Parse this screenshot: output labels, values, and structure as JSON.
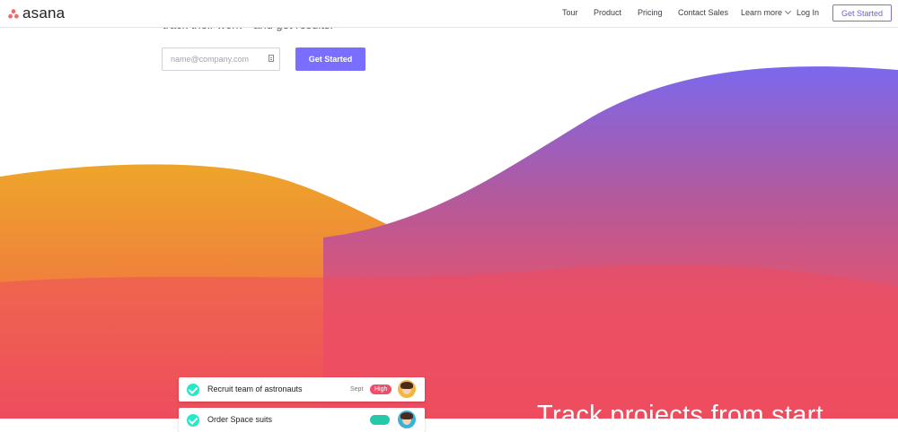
{
  "nav": {
    "brand": "asana",
    "links": [
      "Tour",
      "Product",
      "Pricing",
      "Contact Sales",
      "Learn more",
      "Log In"
    ],
    "cta": "Get Started"
  },
  "hero": {
    "tagline": "track their work—and get results.",
    "email_placeholder": "name@company.com",
    "email_value": "",
    "cta": "Get Started"
  },
  "tasks": [
    {
      "title": "Recruit team of astronauts",
      "date": "Sept",
      "tag": "High"
    },
    {
      "title": "Order Space suits",
      "date": "",
      "tag": ""
    }
  ],
  "section": {
    "title": "Track projects from start"
  },
  "colors": {
    "accent": "#796eff",
    "wave_orange": "#f0a52a",
    "wave_pink": "#ee4d5e",
    "wave_purple": "#7b68ee",
    "check": "#25e8c8",
    "tag_high": "#ef4e6b"
  },
  "icons": [
    "asana-logo-icon",
    "chevron-down-icon",
    "password-manager-icon",
    "check-circle-icon",
    "avatar"
  ]
}
